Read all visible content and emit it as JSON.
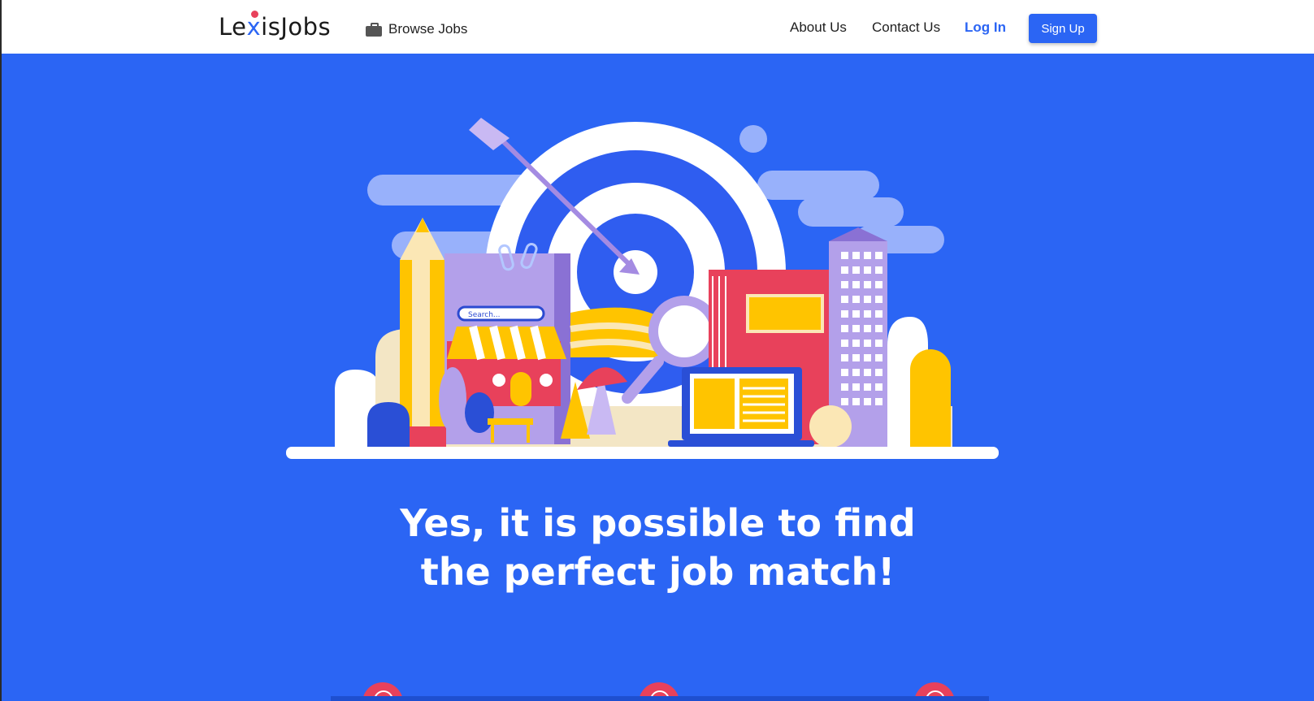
{
  "navbar": {
    "logo_prefix": "Le",
    "logo_x": "x",
    "logo_suffix": "isJobs",
    "browse_label": "Browse Jobs",
    "browse_icon": "briefcase-icon",
    "about_label": "About Us",
    "contact_label": "Contact Us",
    "login_label": "Log In",
    "signup_label": "Sign Up"
  },
  "hero": {
    "search_placeholder": "Search...",
    "headline_line1": "Yes, it is possible to find",
    "headline_line2": "the perfect job match!"
  },
  "colors": {
    "brand_blue": "#2b65f4",
    "accent_red": "#e8415b",
    "accent_yellow": "#ffc400",
    "accent_purple": "#b3a0ea"
  }
}
